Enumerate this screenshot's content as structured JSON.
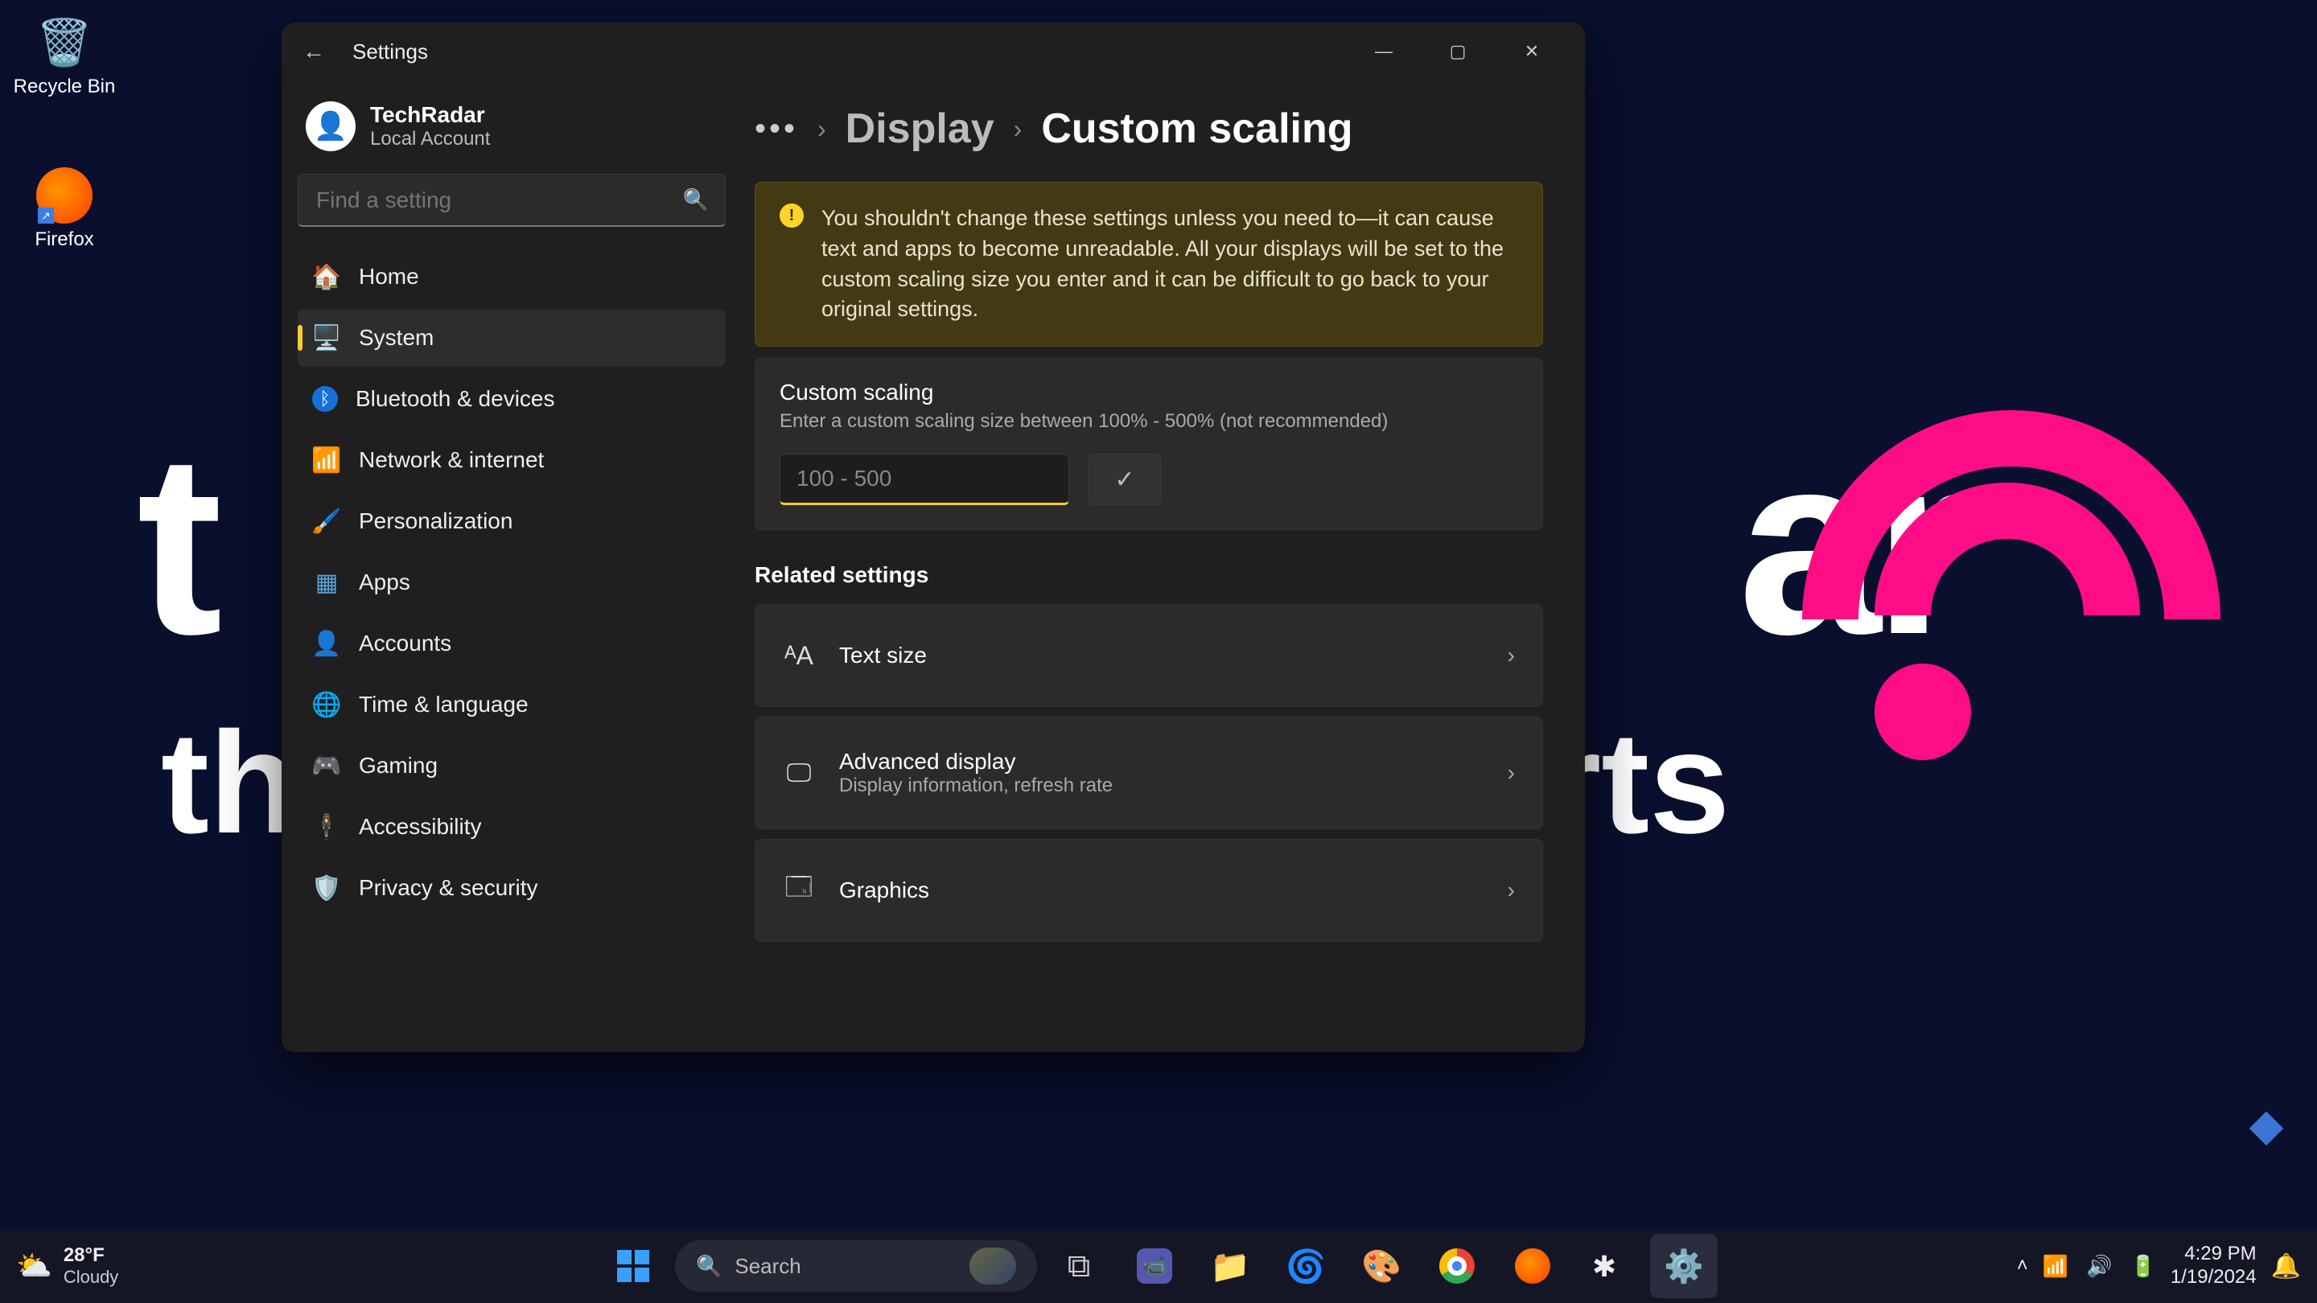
{
  "desktop": {
    "recycle_label": "Recycle Bin",
    "firefox_label": "Firefox"
  },
  "window": {
    "title": "Settings",
    "account_name": "TechRadar",
    "account_type": "Local Account",
    "search_placeholder": "Find a setting",
    "nav": {
      "home": "Home",
      "system": "System",
      "bluetooth": "Bluetooth & devices",
      "network": "Network & internet",
      "personalization": "Personalization",
      "apps": "Apps",
      "accounts": "Accounts",
      "time": "Time & language",
      "gaming": "Gaming",
      "accessibility": "Accessibility",
      "privacy": "Privacy & security"
    },
    "breadcrumb": {
      "parent": "Display",
      "current": "Custom scaling"
    },
    "warning": "You shouldn't change these settings unless you need to—it can cause text and apps to become unreadable. All your displays will be set to the custom scaling size you enter and it can be difficult to go back to your original settings.",
    "custom_scaling": {
      "title": "Custom scaling",
      "desc": "Enter a custom scaling size between 100% - 500% (not recommended)",
      "placeholder": "100 - 500"
    },
    "related_heading": "Related settings",
    "related": {
      "text_size": "Text size",
      "adv_title": "Advanced display",
      "adv_sub": "Display information, refresh rate",
      "graphics": "Graphics"
    }
  },
  "taskbar": {
    "temp": "28°F",
    "cond": "Cloudy",
    "search": "Search",
    "time": "4:29 PM",
    "date": "1/19/2024"
  }
}
